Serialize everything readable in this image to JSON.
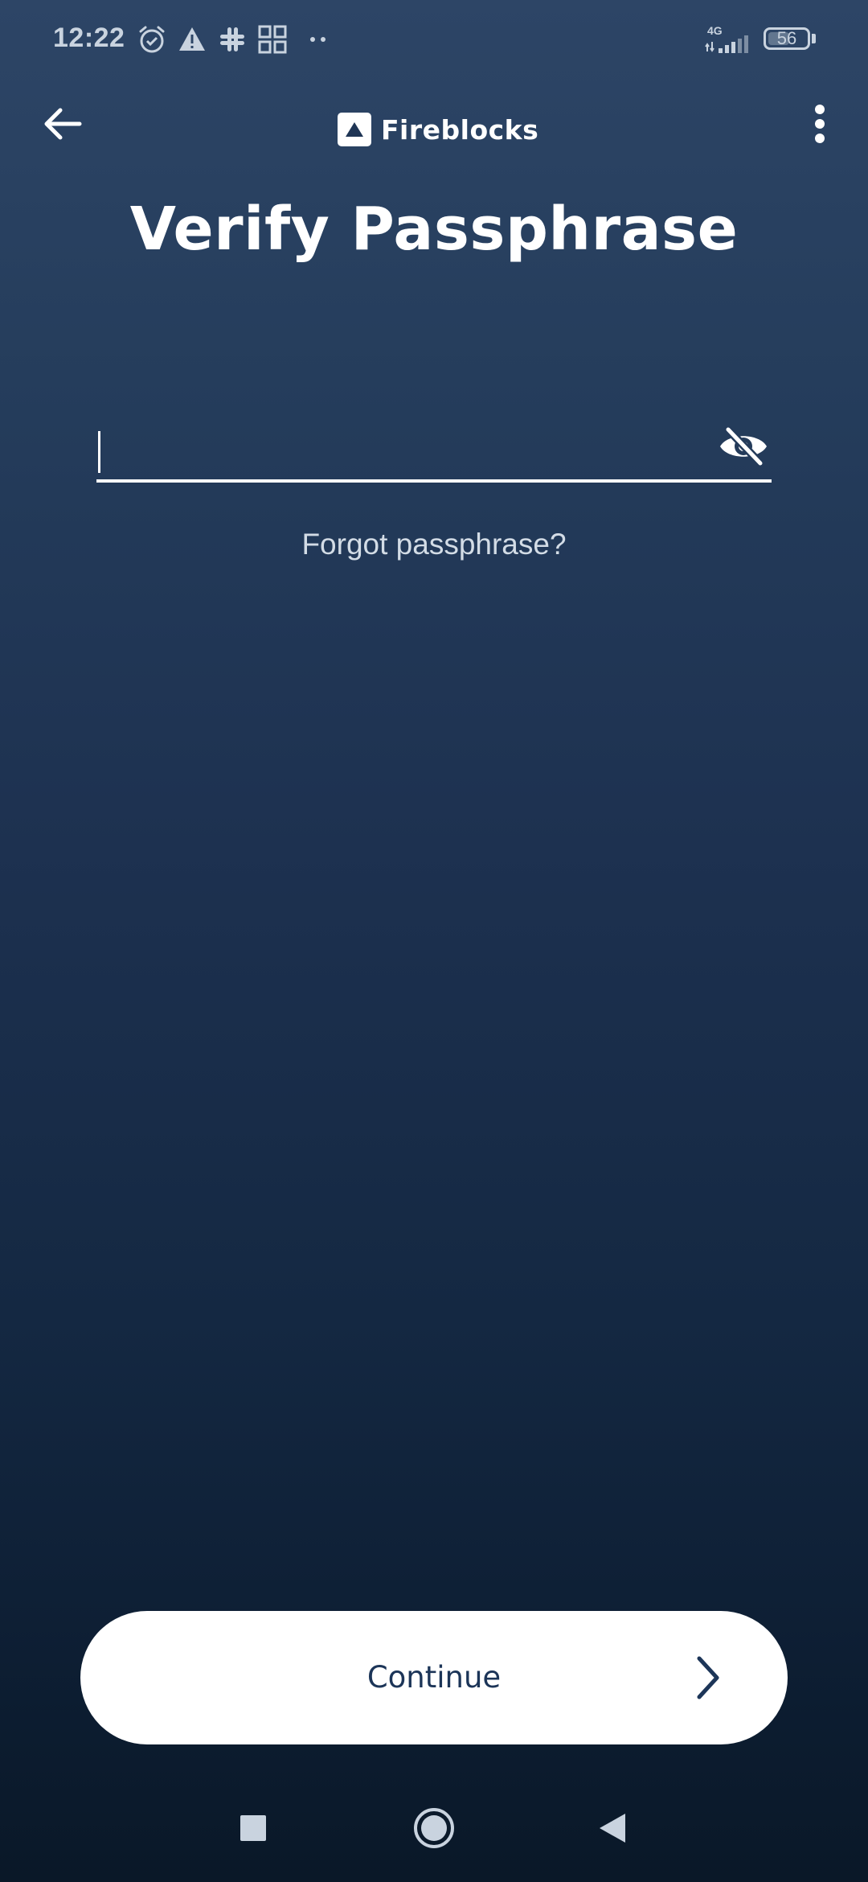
{
  "status_bar": {
    "time": "12:22",
    "network": "4G",
    "battery": "56",
    "battery_level": 0.56,
    "icons": [
      "alarm-icon",
      "warning-icon",
      "slack-icon",
      "qr-icon",
      "more-dots-icon",
      "signal-icon",
      "battery-icon"
    ]
  },
  "app_bar": {
    "brand_name": "Fireblocks",
    "icons": [
      "back-arrow-icon",
      "fireblocks-logo-icon",
      "more-vert-icon"
    ]
  },
  "page": {
    "title": "Verify Passphrase"
  },
  "passphrase_field": {
    "value": "",
    "placeholder": "",
    "visibility_icon": "eye-off-icon"
  },
  "forgot_link": "Forgot passphrase?",
  "continue_button": {
    "label": "Continue",
    "icon": "chevron-right-icon"
  },
  "nav_bar": {
    "icons": [
      "recents-square-icon",
      "home-circle-icon",
      "back-triangle-icon"
    ]
  },
  "colors": {
    "background_top": "#2d4566",
    "background_bottom": "#0a1828",
    "text": "#ffffff",
    "button_text": "#1c3558"
  }
}
